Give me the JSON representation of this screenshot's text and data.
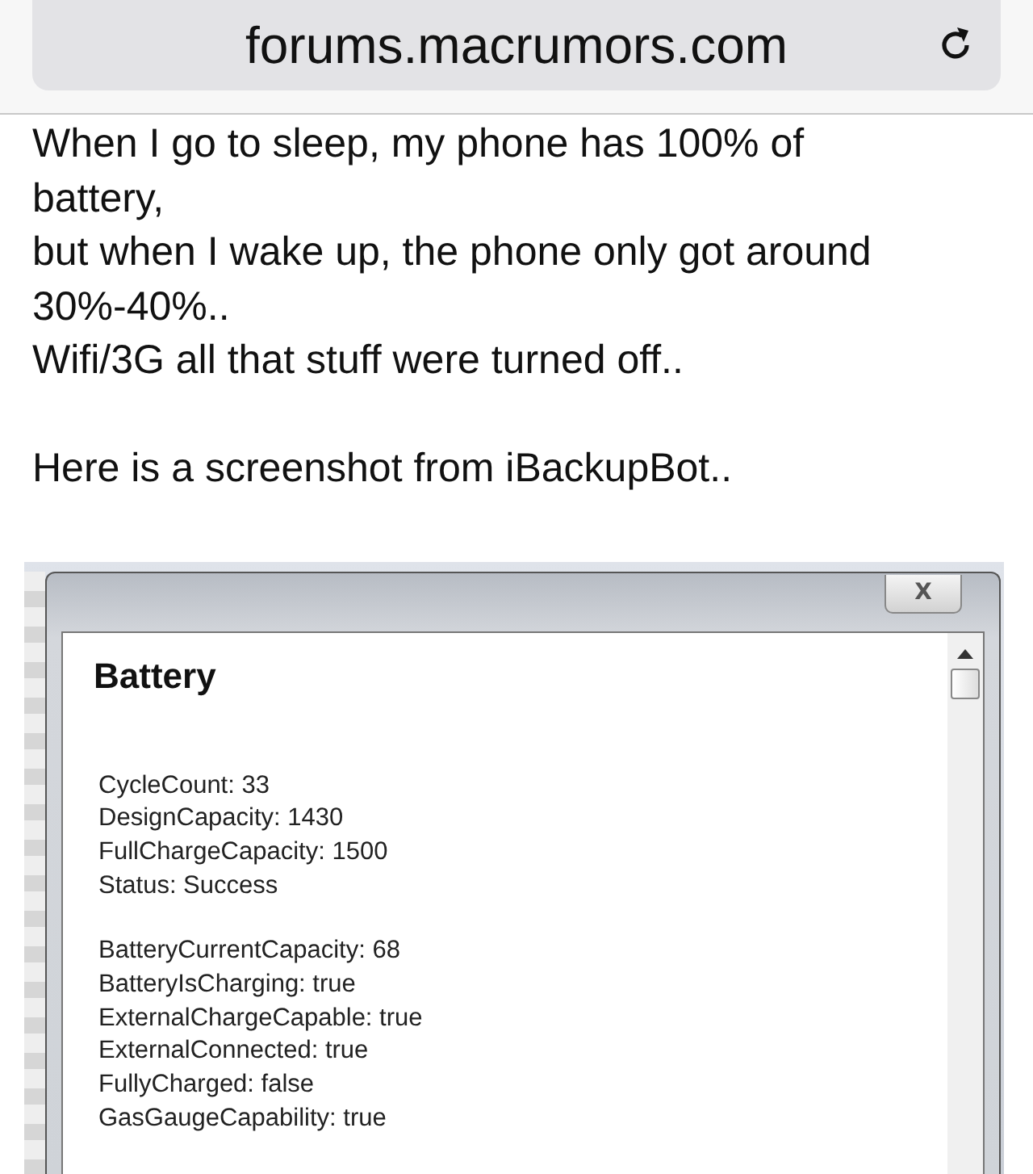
{
  "address_bar": {
    "url": "forums.macrumors.com"
  },
  "post": {
    "paragraphs": [
      [
        "When I go to sleep, my phone has 100% of",
        "battery,",
        "but when I wake up, the phone only got around",
        "30%-40%..",
        "Wifi/3G all that stuff were turned off.."
      ],
      [
        "Here is a screenshot from iBackupBot.."
      ]
    ]
  },
  "dialog": {
    "close": "X",
    "heading": "Battery",
    "groups": [
      [
        "CycleCount: 33",
        "DesignCapacity: 1430",
        "FullChargeCapacity: 1500",
        "Status: Success"
      ],
      [
        "BatteryCurrentCapacity: 68",
        "BatteryIsCharging: true",
        "ExternalChargeCapable: true",
        "ExternalConnected: true",
        "FullyCharged: false",
        "GasGaugeCapability: true"
      ]
    ]
  }
}
